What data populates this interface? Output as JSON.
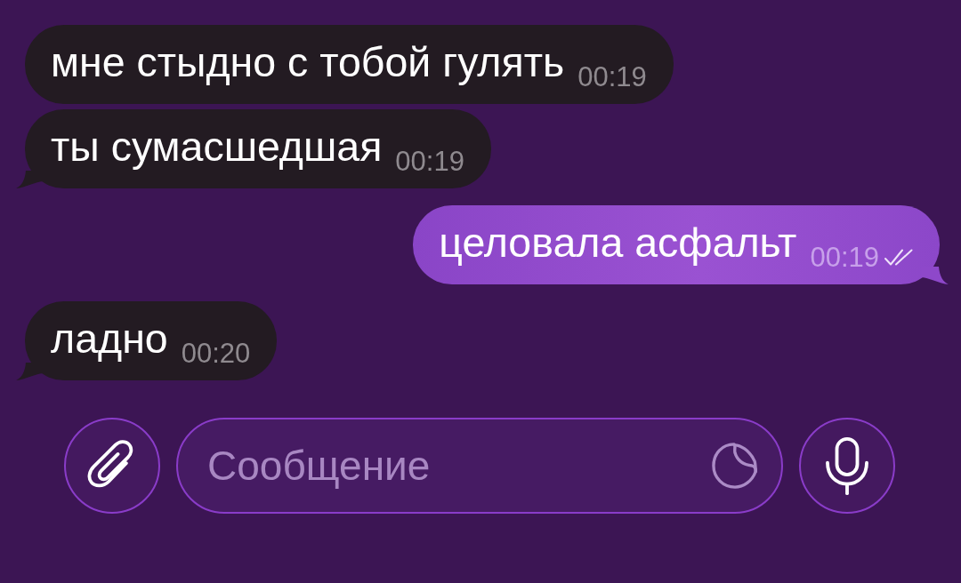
{
  "messages": [
    {
      "kind": "incoming",
      "text": "мне стыдно с тобой гулять",
      "time": "00:19",
      "tail": false
    },
    {
      "kind": "incoming",
      "text": "ты сумасшедшая",
      "time": "00:19",
      "tail": true
    },
    {
      "kind": "outgoing",
      "text": "целовала асфальт",
      "time": "00:19",
      "tail": true,
      "read": true
    },
    {
      "kind": "incoming",
      "text": "ладно",
      "time": "00:20",
      "tail": true
    }
  ],
  "composer": {
    "placeholder": "Сообщение"
  }
}
